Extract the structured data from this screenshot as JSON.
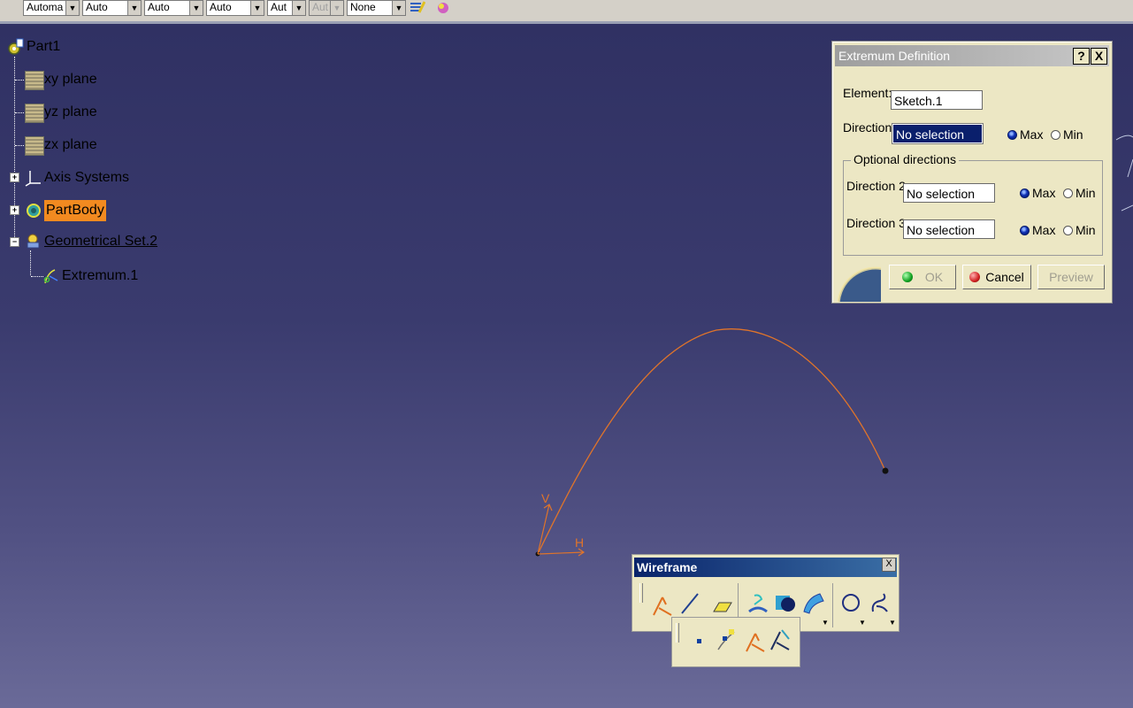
{
  "toolbar": {
    "combos": [
      {
        "value": "Automa",
        "disabled": false
      },
      {
        "value": "Auto",
        "disabled": false
      },
      {
        "value": "Auto",
        "disabled": false
      },
      {
        "value": "Auto",
        "disabled": false
      },
      {
        "value": "Aut",
        "disabled": false
      },
      {
        "value": "Aut",
        "disabled": true
      },
      {
        "value": "None",
        "disabled": false
      }
    ]
  },
  "tree": {
    "root": "Part1",
    "items": [
      {
        "label": "xy plane",
        "icon": "plane-icon"
      },
      {
        "label": "yz plane",
        "icon": "plane-icon"
      },
      {
        "label": "zx plane",
        "icon": "plane-icon"
      },
      {
        "label": "Axis Systems",
        "icon": "axis-systems-icon"
      },
      {
        "label": "PartBody",
        "icon": "partbody-icon"
      },
      {
        "label": "Geometrical Set.2",
        "icon": "geometrical-set-icon"
      },
      {
        "label": "Extremum.1",
        "icon": "extremum-icon"
      }
    ]
  },
  "dialog": {
    "title": "Extremum Definition",
    "help": "?",
    "close": "X",
    "element_label": "Element:",
    "element_value": "Sketch.1",
    "direction_label": "Direction:",
    "direction_value": "No selection",
    "max_label": "Max",
    "min_label": "Min",
    "optional_title": "Optional directions",
    "direction2_label": "Direction 2:",
    "direction2_value": "No selection",
    "direction3_label": "Direction 3:",
    "direction3_value": "No selection",
    "ok": "OK",
    "cancel": "Cancel",
    "preview": "Preview"
  },
  "sketch": {
    "axis_v": "V",
    "axis_h": "H"
  },
  "wireframe": {
    "title": "Wireframe",
    "close": "X"
  },
  "colors": {
    "curve": "#e0742a",
    "highlight": "#f28a20",
    "selection": "#0a1f6c"
  }
}
